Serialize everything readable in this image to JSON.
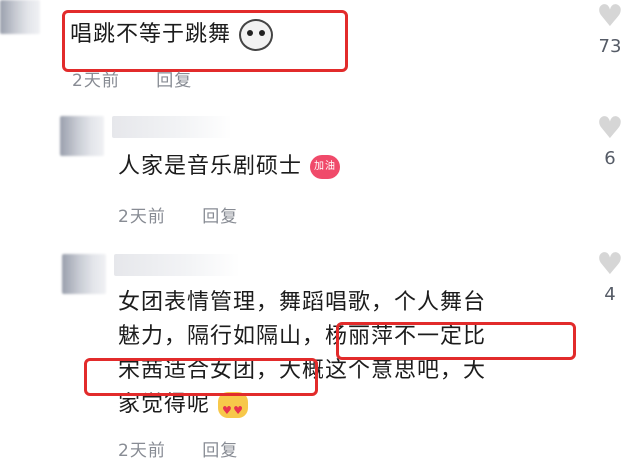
{
  "comments": [
    {
      "text": "唱跳不等于跳舞",
      "time": "2天前",
      "reply": "回复",
      "likes": "73",
      "emoji": "cat-face-emoji"
    },
    {
      "text": "人家是音乐剧硕士",
      "time": "2天前",
      "reply": "回复",
      "likes": "6",
      "emoji": "jiayou-emoji",
      "emoji_text": "加油"
    },
    {
      "lines": [
        "女团表情管理，舞蹈唱歌，个人舞台",
        "魅力，隔行如隔山，杨丽萍不一定比",
        "宋茜适合女团，大概这个意思吧，大",
        "家觉得呢"
      ],
      "time": "2天前",
      "reply": "回复",
      "likes": "4",
      "emoji": "heart-face-emoji"
    }
  ],
  "colors": {
    "highlight": "#e22b2b",
    "meta_text": "#888c94",
    "heart_icon": "#d6d6d6"
  }
}
